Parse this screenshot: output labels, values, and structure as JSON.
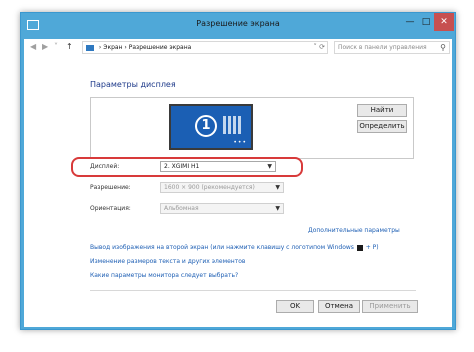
{
  "window": {
    "title": "Разрешение экрана",
    "controls": {
      "minimize": "—",
      "maximize": "□",
      "close": "✕"
    }
  },
  "nav": {
    "back": "◀",
    "forward": "▶",
    "dropdown": "˅",
    "up": "↑"
  },
  "address": {
    "breadcrumb": [
      "Экран",
      "Разрешение экрана"
    ],
    "separator": "›",
    "chevron": "˅",
    "refresh": "⟳"
  },
  "search": {
    "placeholder": "Поиск в панели управления",
    "icon": "search-icon"
  },
  "main": {
    "heading": "Параметры дисплея",
    "monitor_number": "1",
    "buttons": {
      "detect": "Найти",
      "identify": "Определить"
    },
    "settings": [
      {
        "label": "Дисплей:",
        "value": "2. XGIMI H1"
      },
      {
        "label": "Разрешение:",
        "value": "1600 × 900 (рекомендуется)"
      },
      {
        "label": "Ориентация:",
        "value": "Альбомная"
      }
    ],
    "advanced_link": "Дополнительные параметры",
    "links": [
      "Вывод изображения на второй экран (или нажмите клавишу с логотипом Windows",
      "+ P)",
      "Изменение размеров текста и других элементов",
      "Какие параметры монитора следует выбрать?"
    ]
  },
  "footer": {
    "ok": "OK",
    "cancel": "Отмена",
    "apply": "Применить"
  },
  "colors": {
    "titlebar": "#4fa8d8",
    "monitor": "#1b5fb4",
    "highlight": "#d83a3a",
    "link": "#1e5fb4"
  }
}
